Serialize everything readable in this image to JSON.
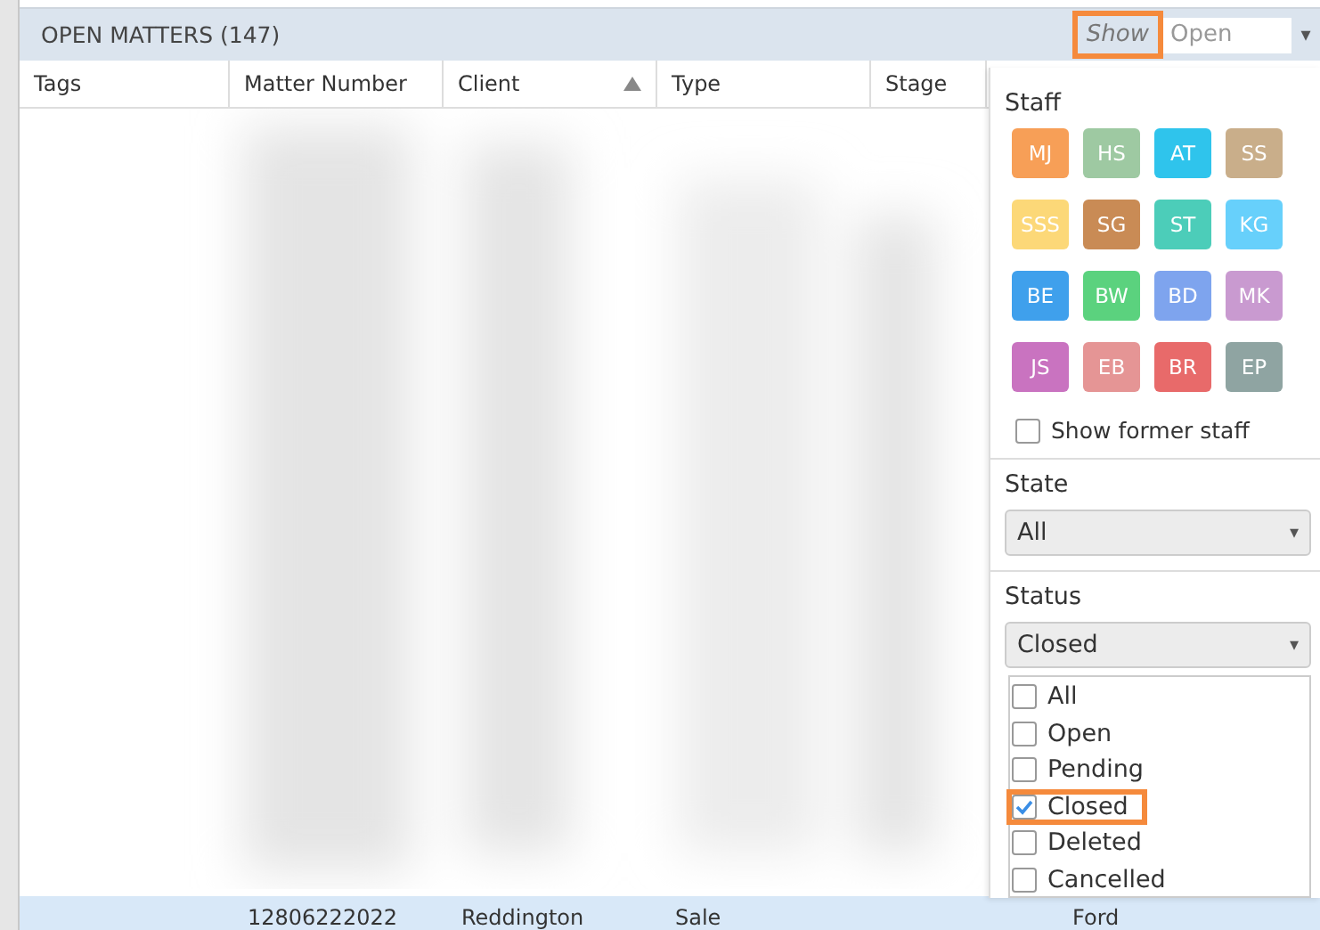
{
  "header": {
    "title": "OPEN MATTERS (147)",
    "show_label": "Show",
    "show_highlighted": true,
    "show_value": "Open",
    "show_arrow": "▾"
  },
  "table": {
    "columns": [
      {
        "label": "Tags",
        "sorted": false
      },
      {
        "label": "Matter Number",
        "sorted": false
      },
      {
        "label": "Client",
        "sorted": true
      },
      {
        "label": "Type",
        "sorted": false
      },
      {
        "label": "Stage",
        "sorted": false
      }
    ],
    "blurred_rows": true,
    "selected_row": {
      "selected": true,
      "cells": [
        "",
        "12806222022",
        "Reddington",
        "Sale",
        "",
        "Ford"
      ]
    }
  },
  "filter_panel": {
    "staff_label": "Staff",
    "staff": [
      {
        "initials": "MJ",
        "color": "#f79f57"
      },
      {
        "initials": "HS",
        "color": "#9ec9a2"
      },
      {
        "initials": "AT",
        "color": "#2fc4ec"
      },
      {
        "initials": "SS",
        "color": "#c9ae8a"
      },
      {
        "initials": "SSS",
        "color": "#fcd878"
      },
      {
        "initials": "SG",
        "color": "#c98b55"
      },
      {
        "initials": "ST",
        "color": "#4ccdb9"
      },
      {
        "initials": "KG",
        "color": "#67d0fb"
      },
      {
        "initials": "BE",
        "color": "#3fa0ec"
      },
      {
        "initials": "BW",
        "color": "#5bd27e"
      },
      {
        "initials": "BD",
        "color": "#7ea4ee"
      },
      {
        "initials": "MK",
        "color": "#c99ad0"
      },
      {
        "initials": "JS",
        "color": "#c973c0"
      },
      {
        "initials": "EB",
        "color": "#e59595"
      },
      {
        "initials": "BR",
        "color": "#e86a6a"
      },
      {
        "initials": "EP",
        "color": "#8fa4a2"
      }
    ],
    "show_former_staff": {
      "label": "Show former staff",
      "checked": false
    },
    "state": {
      "label": "State",
      "value": "All",
      "arrow": "▾"
    },
    "status": {
      "label": "Status",
      "value": "Closed",
      "arrow": "▾",
      "options": [
        {
          "label": "All",
          "checked": false,
          "highlighted": false
        },
        {
          "label": "Open",
          "checked": false,
          "highlighted": false
        },
        {
          "label": "Pending",
          "checked": false,
          "highlighted": false
        },
        {
          "label": "Closed",
          "checked": true,
          "highlighted": true
        },
        {
          "label": "Deleted",
          "checked": false,
          "highlighted": false
        },
        {
          "label": "Cancelled",
          "checked": false,
          "highlighted": false
        }
      ]
    }
  }
}
